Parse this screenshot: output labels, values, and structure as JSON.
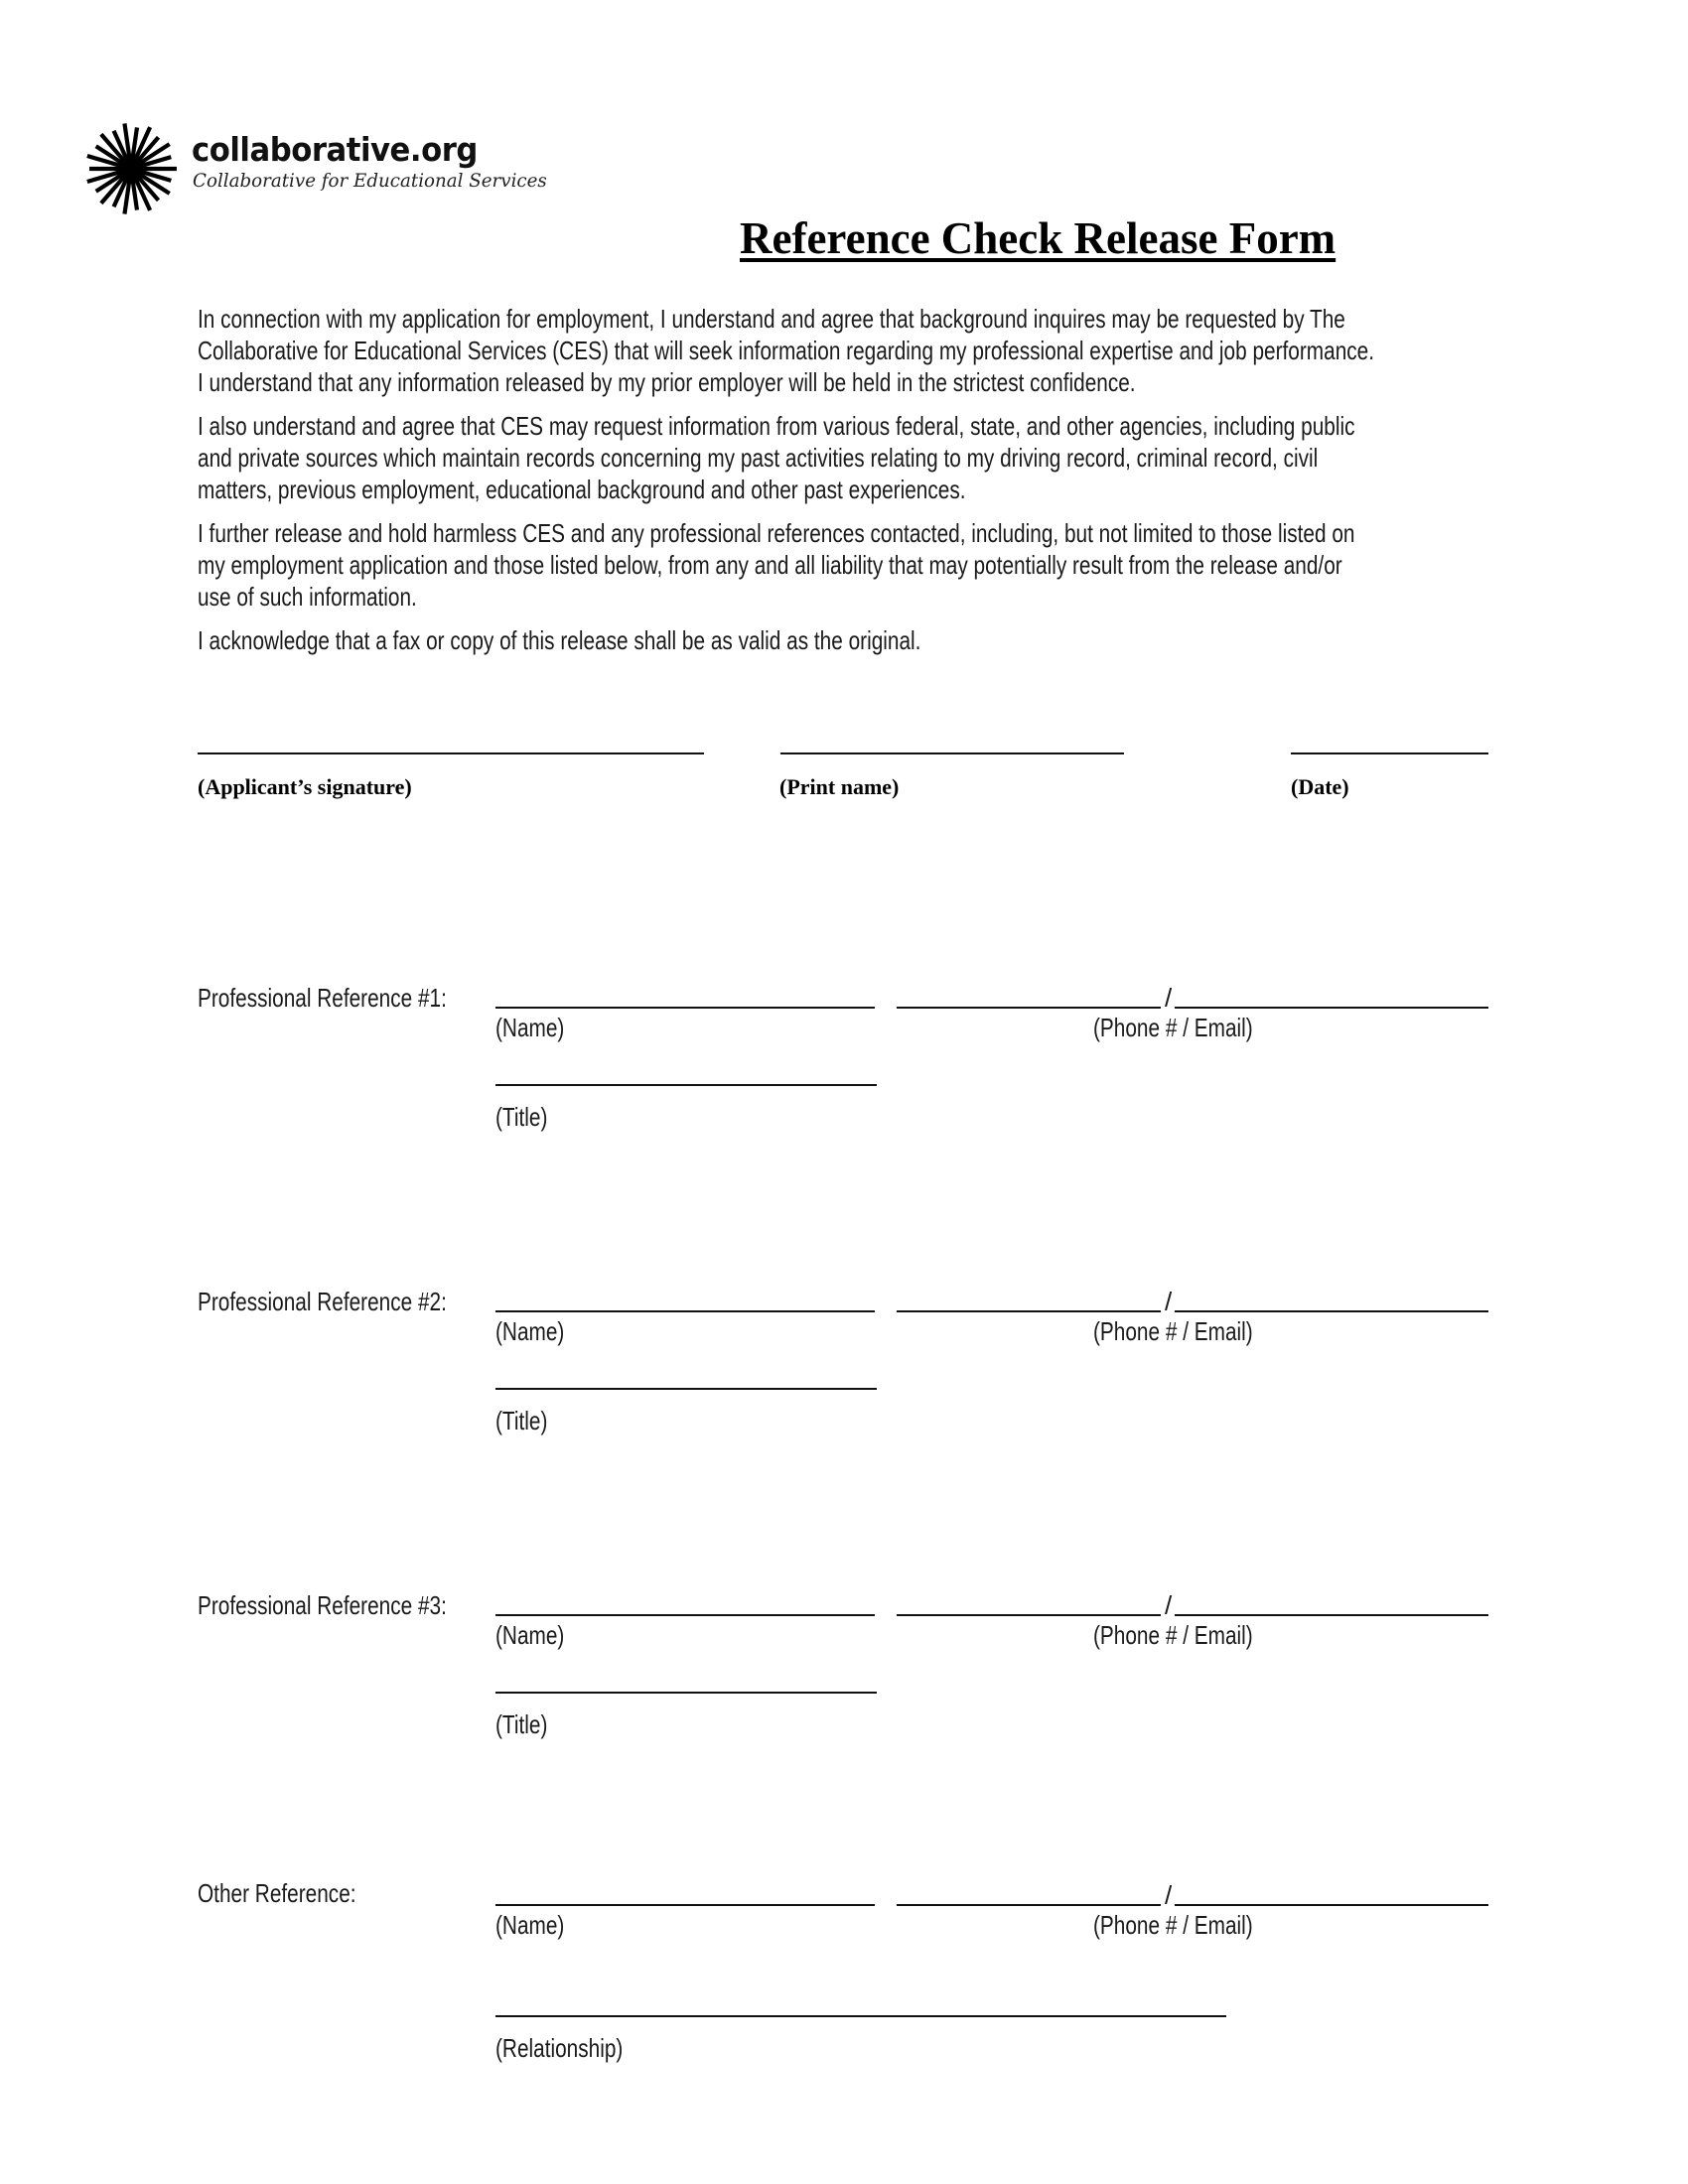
{
  "logo": {
    "icon": "starburst-icon",
    "name": "collaborative.org",
    "subtitle": "Collaborative for Educational Services"
  },
  "title": "Reference Check Release Form",
  "paragraphs": [
    {
      "lines": [
        "In connection with my application for employment, I understand and agree that background inquires may be requested by The",
        "Collaborative for Educational Services (CES) that will seek information regarding my professional expertise and job performance.",
        "I understand that any information released by my prior employer will be held in the strictest confidence."
      ]
    },
    {
      "lines": [
        "I also understand and agree that CES may request information from various federal, state, and other agencies, including public",
        "and private sources which maintain records concerning my past activities relating to my driving record, criminal record, civil",
        "matters, previous employment, educational background and other past experiences."
      ]
    },
    {
      "lines": [
        "I further release and hold harmless CES and any professional references contacted, including, but not limited to  those listed on",
        "my employment application and those listed below,  from any and all liability that may potentially result from the release and/or",
        "use of such information."
      ]
    },
    {
      "lines": [
        "I acknowledge that a fax or copy of this release shall be as valid as the original."
      ]
    }
  ],
  "signature": {
    "applicant_label": "(Applicant’s signature)",
    "print_name_label": "(Print name)",
    "date_label": "(Date)"
  },
  "references": [
    {
      "label": "Professional Reference #1:",
      "name_label": "(Name)",
      "contact_label": "(Phone # / Email)",
      "separator": "/",
      "extra_label": "(Title)"
    },
    {
      "label": "Professional Reference #2:",
      "name_label": "(Name)",
      "contact_label": "(Phone # / Email)",
      "separator": "/",
      "extra_label": "(Title)"
    },
    {
      "label": "Professional Reference #3:",
      "name_label": "(Name)",
      "contact_label": "(Phone # / Email)",
      "separator": "/",
      "extra_label": "(Title)"
    },
    {
      "label": "Other Reference:",
      "name_label": "(Name)",
      "contact_label": "(Phone # / Email)",
      "separator": "/",
      "extra_label": "(Relationship)"
    }
  ]
}
